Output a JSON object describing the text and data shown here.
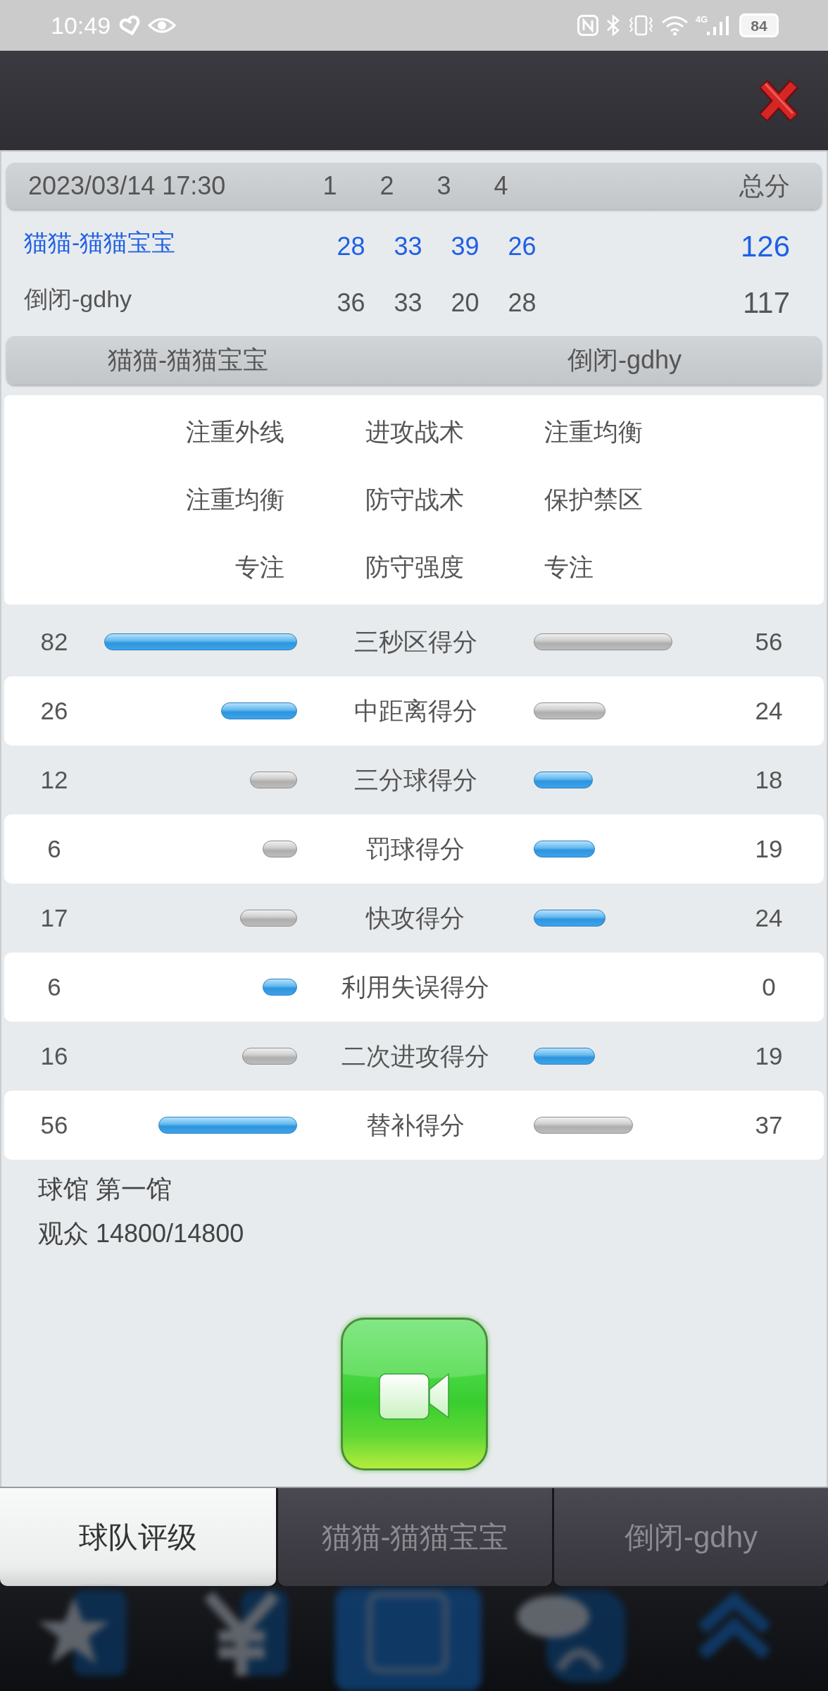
{
  "status_bar": {
    "time": "10:49",
    "network": "4G",
    "battery": "84"
  },
  "scoreboard": {
    "date": "2023/03/14 17:30",
    "periods": [
      "1",
      "2",
      "3",
      "4"
    ],
    "total_label": "总分",
    "teams": [
      {
        "name": "猫猫-猫猫宝宝",
        "scores": [
          "28",
          "33",
          "39",
          "26"
        ],
        "total": "126",
        "highlighted": true
      },
      {
        "name": "倒闭-gdhy",
        "scores": [
          "36",
          "33",
          "20",
          "28"
        ],
        "total": "117",
        "highlighted": false
      }
    ]
  },
  "matchup": {
    "home": "猫猫-猫猫宝宝",
    "away": "倒闭-gdhy"
  },
  "tactics": [
    {
      "home": "注重外线",
      "label": "进攻战术",
      "away": "注重均衡"
    },
    {
      "home": "注重均衡",
      "label": "防守战术",
      "away": "保护禁区"
    },
    {
      "home": "专注",
      "label": "防守强度",
      "away": "专注"
    }
  ],
  "stats": [
    {
      "label": "三秒区得分",
      "home": "82",
      "away": "56"
    },
    {
      "label": "中距离得分",
      "home": "26",
      "away": "24"
    },
    {
      "label": "三分球得分",
      "home": "12",
      "away": "18"
    },
    {
      "label": "罚球得分",
      "home": "6",
      "away": "19"
    },
    {
      "label": "快攻得分",
      "home": "17",
      "away": "24"
    },
    {
      "label": "利用失误得分",
      "home": "6",
      "away": "0"
    },
    {
      "label": "二次进攻得分",
      "home": "16",
      "away": "19"
    },
    {
      "label": "替补得分",
      "home": "56",
      "away": "37"
    }
  ],
  "venue": "球馆 第一馆",
  "attendance": "观众 14800/14800",
  "tabs": [
    {
      "label": "球队评级",
      "selected": true
    },
    {
      "label": "猫猫-猫猫宝宝",
      "selected": false
    },
    {
      "label": "倒闭-gdhy",
      "selected": false
    }
  ]
}
